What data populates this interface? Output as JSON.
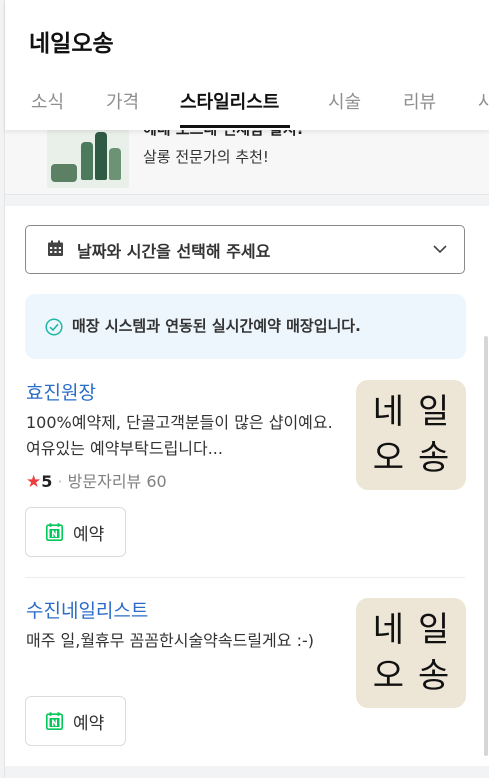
{
  "header": {
    "title": "네일오송"
  },
  "tabs": [
    {
      "label": "소식"
    },
    {
      "label": "가격"
    },
    {
      "label": "스타일리스트"
    },
    {
      "label": "시술"
    },
    {
      "label": "리뷰"
    },
    {
      "label": "사"
    }
  ],
  "promo": {
    "line1": "헤네 오드네 인체함 할지!",
    "line2": "살롱 전문가의 추천!"
  },
  "booking": {
    "date_placeholder": "날짜와 시간을 선택해 주세요",
    "notice": "매장 시스템과 연동된 실시간예약 매장입니다."
  },
  "stylists": [
    {
      "name": "효진원장",
      "description": "100%예약제, 단골고객분들이 많은 샵이예요. 여유있는 예약부탁드립니다...",
      "rating": "5",
      "review_label": "방문자리뷰 60",
      "thumb_line1": "네일",
      "thumb_line2": "오송",
      "book_label": "예약"
    },
    {
      "name": "수진네일리스트",
      "description": "매주 일,월휴무 꼼꼼한시술약속드릴게요 :-)",
      "thumb_line1": "네일",
      "thumb_line2": "오송",
      "book_label": "예약"
    }
  ],
  "colors": {
    "accent_link": "#2a6cc9",
    "naver_green": "#03c75a",
    "star": "#ef3d3d",
    "notice_bg": "#eef6fd"
  }
}
